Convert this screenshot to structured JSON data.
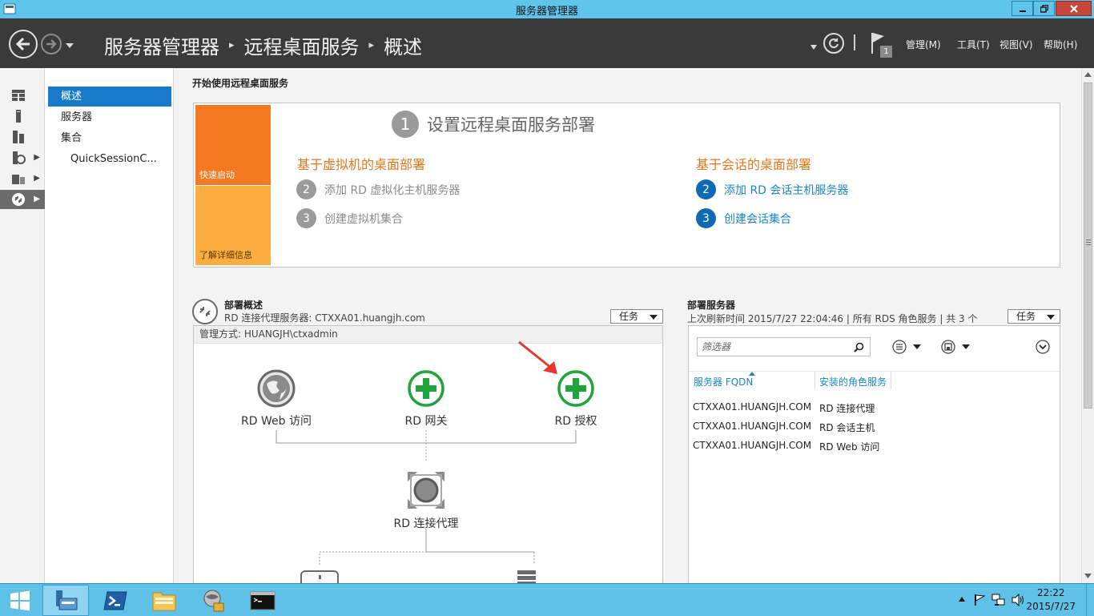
{
  "window": {
    "title": "服务器管理器"
  },
  "header": {
    "breadcrumb": [
      "服务器管理器",
      "远程桌面服务",
      "概述"
    ],
    "notification_count": "1",
    "menu": [
      "管理(M)",
      "工具(T)",
      "视图(V)",
      "帮助(H)"
    ]
  },
  "nav": {
    "items": [
      {
        "label": "概述",
        "selected": true
      },
      {
        "label": "服务器",
        "selected": false
      },
      {
        "label": "集合",
        "selected": false
      },
      {
        "label": "QuickSessionC...",
        "selected": false,
        "indented": true
      }
    ]
  },
  "getting_started": {
    "title": "开始使用远程桌面服务",
    "tile_quick_start": "快速启动",
    "tile_learn_more": "了解详细信息",
    "step1_num": "1",
    "step1_title": "设置远程桌面服务部署",
    "vm_heading": "基于虚拟机的桌面部署",
    "vm_steps": [
      {
        "num": "2",
        "label": "添加 RD 虚拟化主机服务器"
      },
      {
        "num": "3",
        "label": "创建虚拟机集合"
      }
    ],
    "session_heading": "基于会话的桌面部署",
    "session_steps": [
      {
        "num": "2",
        "label": "添加 RD 会话主机服务器"
      },
      {
        "num": "3",
        "label": "创建会话集合"
      }
    ]
  },
  "deployment_overview": {
    "title": "部署概述",
    "subtitle": "RD 连接代理服务器: CTXXA01.huangjh.com",
    "tasks_label": "任务",
    "managed_as": "管理方式: HUANGJH\\ctxadmin",
    "roles": {
      "web": "RD Web 访问",
      "gateway": "RD 网关",
      "licensing": "RD 授权",
      "broker": "RD 连接代理"
    }
  },
  "deployment_servers": {
    "title": "部署服务器",
    "subtitle": "上次刷新时间 2015/7/27 22:04:46 | 所有 RDS 角色服务 | 共 3 个",
    "tasks_label": "任务",
    "filter_placeholder": "筛选器",
    "columns": [
      "服务器 FQDN",
      "安装的角色服务"
    ],
    "rows": [
      [
        "CTXXA01.HUANGJH.COM",
        "RD 连接代理"
      ],
      [
        "CTXXA01.HUANGJH.COM",
        "RD 会话主机"
      ],
      [
        "CTXXA01.HUANGJH.COM",
        "RD Web 访问"
      ]
    ]
  },
  "taskbar": {
    "time": "22:22",
    "date": "2015/7/27"
  },
  "colors": {
    "accent_blue": "#1979ca",
    "orange": "#f47920",
    "light_orange": "#fbad3f",
    "link_blue": "#1a86c7",
    "heading_orange": "#e5761b",
    "taskbar": "#5fc0e8",
    "header": "#3a3a3a"
  }
}
